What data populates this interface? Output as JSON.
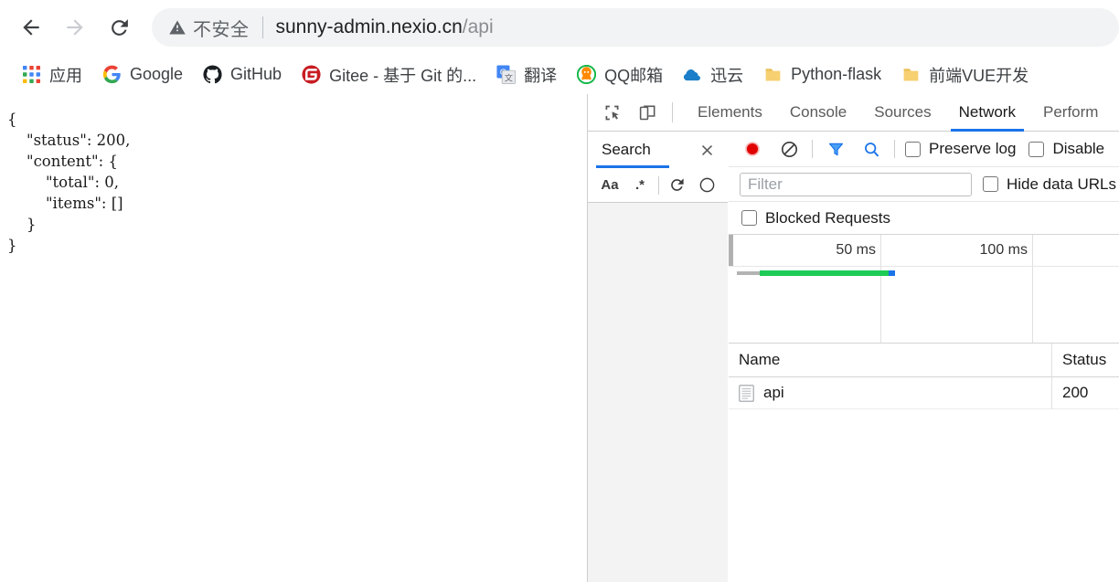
{
  "browser": {
    "nav": {
      "back_icon": "arrow-left-icon",
      "forward_icon": "arrow-right-icon",
      "reload_icon": "reload-icon"
    },
    "omnibox": {
      "security_icon": "warning-triangle-icon",
      "security_text": "不安全",
      "url_domain": "sunny-admin.nexio.cn",
      "url_path": "/api",
      "full_url": "sunny-admin.nexio.cn/api"
    },
    "bookmarks": [
      {
        "label": "应用",
        "icon": "apps-grid-icon"
      },
      {
        "label": "Google",
        "icon": "google-icon"
      },
      {
        "label": "GitHub",
        "icon": "github-icon"
      },
      {
        "label": "Gitee - 基于 Git 的...",
        "icon": "gitee-icon"
      },
      {
        "label": "翻译",
        "icon": "google-translate-icon"
      },
      {
        "label": "QQ邮箱",
        "icon": "qq-mail-icon"
      },
      {
        "label": "迅云",
        "icon": "cloud-icon"
      },
      {
        "label": "Python-flask",
        "icon": "folder-icon"
      },
      {
        "label": "前端VUE开发",
        "icon": "folder-icon"
      }
    ]
  },
  "page": {
    "response_json": "{\n    \"status\": 200,\n    \"content\": {\n        \"total\": 0,\n        \"items\": []\n    }\n}"
  },
  "devtools": {
    "toolbar": {
      "inspect_icon": "inspect-element-icon",
      "device_icon": "device-toolbar-icon"
    },
    "tabs": [
      {
        "label": "Elements",
        "active": false
      },
      {
        "label": "Console",
        "active": false
      },
      {
        "label": "Sources",
        "active": false
      },
      {
        "label": "Network",
        "active": true
      },
      {
        "label": "Perform",
        "active": false
      }
    ],
    "search_panel": {
      "title": "Search",
      "close_icon": "close-icon",
      "match_case_label": "Aa",
      "regex_label": ".*",
      "refresh_icon": "refresh-icon",
      "clear_icon": "clear-icon"
    },
    "network": {
      "record_icon": "record-dot-icon",
      "clear_icon": "clear-prohibited-icon",
      "filter_icon": "funnel-filter-icon",
      "search_icon": "search-magnifier-icon",
      "preserve_log_label": "Preserve log",
      "disable_cache_label": "Disable",
      "filter_placeholder": "Filter",
      "hide_data_urls_label": "Hide data URLs",
      "blocked_requests_label": "Blocked Requests",
      "overview": {
        "tick_50": "50 ms",
        "tick_100": "100 ms",
        "bar_gray_color": "#b3b3b3",
        "bar_green_color": "#1ecb56",
        "bar_blue_color": "#1a73e8"
      },
      "table": {
        "columns": [
          "Name",
          "Status"
        ],
        "rows": [
          {
            "name": "api",
            "status": "200",
            "icon": "document-icon"
          }
        ]
      }
    }
  },
  "colors": {
    "accent": "#1a73e8",
    "record": "#e81123",
    "success": "#1ecb56",
    "omnibox_bg": "#f1f3f4"
  }
}
